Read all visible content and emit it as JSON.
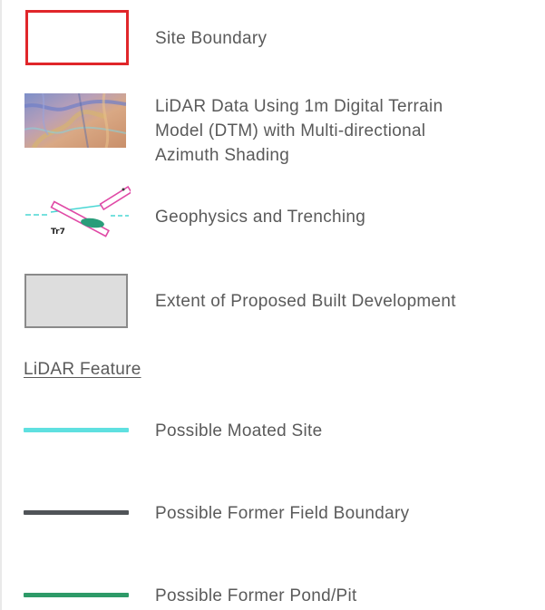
{
  "legend": {
    "items": [
      {
        "label": "Site Boundary",
        "symbol": "red-outline-rectangle",
        "color": "#e0262a"
      },
      {
        "label_lines": [
          "LiDAR Data Using 1m Digital Terrain",
          "Model (DTM) with Multi-directional",
          "Azimuth Shading"
        ],
        "symbol": "lidar-shaded-swatch"
      },
      {
        "label": "Geophysics and Trenching",
        "symbol": "geophysics-trench-icon",
        "trench_label": "Tr7",
        "colors": {
          "trench": "#e04aa6",
          "feature": "#2a9d7a",
          "line": "#4ad7d4"
        }
      },
      {
        "label": "Extent of Proposed Built Development",
        "symbol": "grey-filled-rectangle",
        "color": "#dddddd"
      }
    ],
    "lidar_section": {
      "heading": "LiDAR Feature",
      "items": [
        {
          "label": "Possible Moated Site",
          "color": "#5fe0e0"
        },
        {
          "label": "Possible Former Field Boundary",
          "color": "#505458"
        },
        {
          "label": "Possible Former Pond/Pit",
          "color": "#2e9a68"
        }
      ]
    }
  }
}
